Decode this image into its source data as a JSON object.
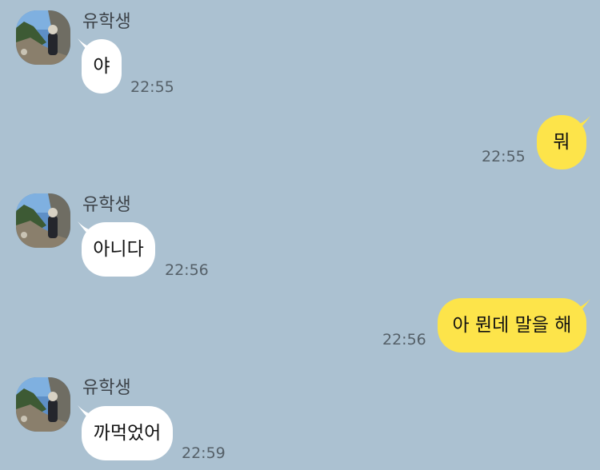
{
  "colors": {
    "background": "#abc1d1",
    "incoming_bubble": "#ffffff",
    "outgoing_bubble": "#fde44a",
    "sender_name": "#3d4349",
    "timestamp": "#556068"
  },
  "icons": {
    "avatar": "profile-photo-icon"
  },
  "messages": [
    {
      "direction": "incoming",
      "sender": "유학생",
      "text": "야",
      "time": "22:55"
    },
    {
      "direction": "outgoing",
      "text": "뭐",
      "time": "22:55"
    },
    {
      "direction": "incoming",
      "sender": "유학생",
      "text": "아니다",
      "time": "22:56"
    },
    {
      "direction": "outgoing",
      "text": "아 뭔데 말을 해",
      "time": "22:56"
    },
    {
      "direction": "incoming",
      "sender": "유학생",
      "text": "까먹었어",
      "time": "22:59"
    }
  ]
}
